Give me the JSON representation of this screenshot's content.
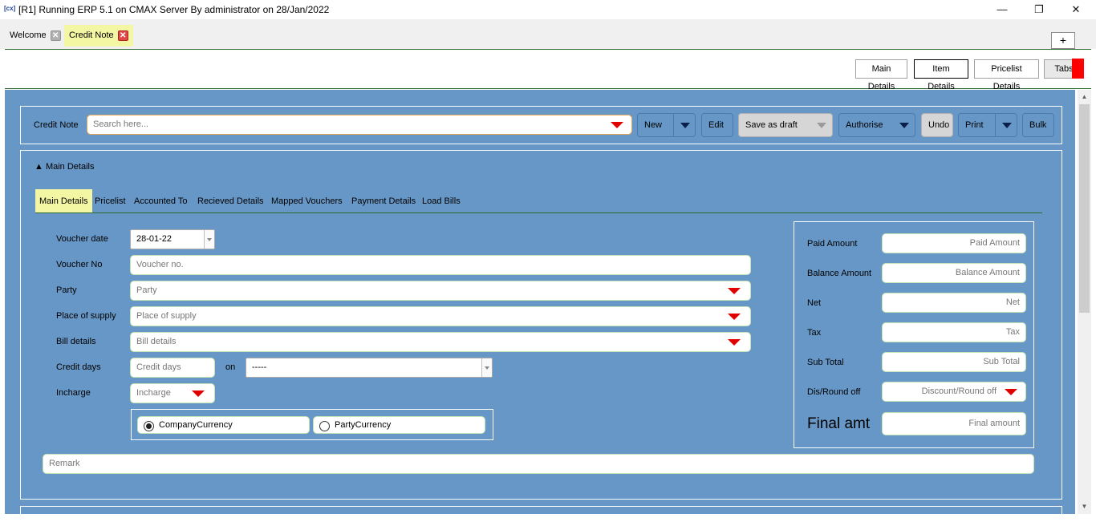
{
  "window": {
    "icon": "[cx]",
    "title": "[R1] Running ERP 5.1 on CMAX Server By administrator on 28/Jan/2022",
    "minimize": "—",
    "maximize": "❐",
    "close": "✕"
  },
  "tabs": [
    {
      "label": "Welcome",
      "active": false
    },
    {
      "label": "Credit Note",
      "active": true
    }
  ],
  "add_tab": "+",
  "toolbar": {
    "main_details": "Main Details",
    "item_details": "Item Details",
    "pricelist_details": "Pricelist Details",
    "tabs": "Tabs"
  },
  "header": {
    "label": "Credit Note",
    "search_placeholder": "Search here...",
    "new": "New",
    "edit": "Edit",
    "save_as_draft": "Save as draft",
    "authorise": "Authorise",
    "undo": "Undo",
    "print": "Print",
    "bulk": "Bulk"
  },
  "section": {
    "title": "▲ Main Details"
  },
  "subtabs": [
    "Main Details",
    "Pricelist",
    "Accounted To",
    "Recieved Details",
    "Mapped Vouchers",
    "Payment Details",
    "Load Bills"
  ],
  "form": {
    "voucher_date": {
      "label": "Voucher date",
      "value": "28-01-22"
    },
    "voucher_no": {
      "label": "Voucher No",
      "placeholder": "Voucher no."
    },
    "party": {
      "label": "Party",
      "placeholder": "Party"
    },
    "place_of_supply": {
      "label": "Place of supply",
      "placeholder": "Place of supply"
    },
    "bill_details": {
      "label": "Bill details",
      "placeholder": "Bill details"
    },
    "credit_days": {
      "label": "Credit days",
      "placeholder": "Credit days",
      "on_label": "on",
      "on_value": "-----"
    },
    "incharge": {
      "label": "Incharge",
      "placeholder": "Incharge"
    },
    "currency": {
      "company": "CompanyCurrency",
      "party": "PartyCurrency",
      "selected": "company"
    },
    "remark": {
      "placeholder": "Remark"
    }
  },
  "summary": {
    "paid_amount": {
      "label": "Paid Amount",
      "placeholder": "Paid Amount"
    },
    "balance_amount": {
      "label": "Balance Amount",
      "placeholder": "Balance Amount"
    },
    "net": {
      "label": "Net",
      "placeholder": "Net"
    },
    "tax": {
      "label": "Tax",
      "placeholder": "Tax"
    },
    "sub_total": {
      "label": "Sub Total",
      "placeholder": "Sub Total"
    },
    "dis_round_off": {
      "label": "Dis/Round off",
      "placeholder": "Discount/Round off"
    },
    "final_amt": {
      "label": "Final amt",
      "placeholder": "Final amount"
    }
  },
  "colors": {
    "canvas": "#6797c6",
    "active_tab": "#f3f7a3",
    "tab_close_active": "#e04848",
    "dropdown_arrow": "#e00000",
    "field_border": "#c6e3b6"
  }
}
